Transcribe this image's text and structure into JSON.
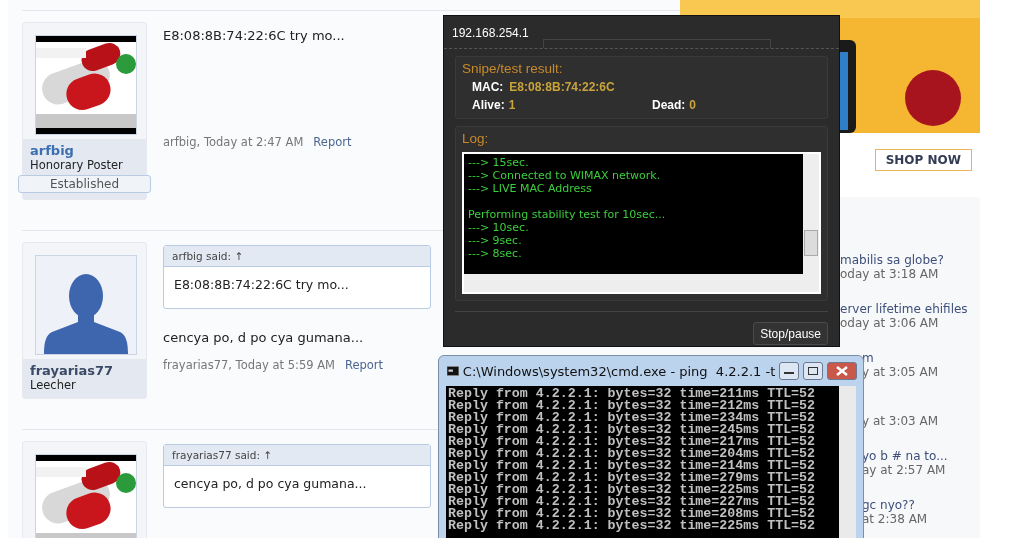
{
  "posts": [
    {
      "author": "arfbig",
      "color": "#3d6fb0",
      "user_title": "Honorary Poster",
      "banner": "Established",
      "message": "E8:08:8B:74:22:6C try mo...",
      "meta": "arfbig, Today at 2:47 AM",
      "report": "Report"
    },
    {
      "avatar": {
        "kind": "silhouette"
      },
      "author": "frayarias77",
      "color": "#3b4a66",
      "user_title": "Leecher",
      "quote": {
        "attribution": "arfbig said: ↑",
        "text": "E8:08:8B:74:22:6C try mo..."
      },
      "message": "cencya po, d po cya gumana...",
      "meta": "frayarias77, Today at 5:59 AM",
      "report": "Report"
    },
    {
      "quote": {
        "attribution": "frayarias77 said: ↑",
        "text": "cencya po, d po cya gumana..."
      }
    }
  ],
  "sidebar": {
    "shop_button": "SHOP NOW",
    "threads": [
      {
        "title": "mabilis sa globe?",
        "meta": "oday at 3:18 AM"
      },
      {
        "title": "erver lifetime ehifiles",
        "meta": "oday at 3:06 AM"
      },
      {
        "title": "m",
        "meta": "y at 3:05 AM"
      },
      {
        "meta": "y at 3:03 AM"
      },
      {
        "title": "yo b # na to...",
        "meta": "ay at 2:57 AM"
      },
      {
        "title": "gc nyo??",
        "meta": "at 2:38 AM"
      }
    ]
  },
  "sniper_window": {
    "tab": "192.168.254.1",
    "result_heading": "Snipe/test result:",
    "mac_label": "MAC:",
    "mac": "E8:08:8B:74:22:6C",
    "alive_label": "Alive:",
    "alive": "1",
    "dead_label": "Dead:",
    "dead": "0",
    "log_heading": "Log:",
    "log_blocks": [
      [
        "---> 15sec.",
        "---> Connected to WIMAX network.",
        "---> LIVE MAC Address"
      ],
      [
        "Performing stability test for 10sec...",
        "---> 10sec.",
        "---> 9sec.",
        "---> 8sec."
      ]
    ],
    "button": "Stop/pause"
  },
  "cmd_window": {
    "title": "C:\\Windows\\system32\\cmd.exe - ping  4.2.2.1 -t",
    "lines": [
      "Reply from 4.2.2.1: bytes=32 time=211ms TTL=52",
      "Reply from 4.2.2.1: bytes=32 time=212ms TTL=52",
      "Reply from 4.2.2.1: bytes=32 time=234ms TTL=52",
      "Reply from 4.2.2.1: bytes=32 time=245ms TTL=52",
      "Reply from 4.2.2.1: bytes=32 time=217ms TTL=52",
      "Reply from 4.2.2.1: bytes=32 time=204ms TTL=52",
      "Reply from 4.2.2.1: bytes=32 time=214ms TTL=52",
      "Reply from 4.2.2.1: bytes=32 time=279ms TTL=52",
      "Reply from 4.2.2.1: bytes=32 time=225ms TTL=52",
      "Reply from 4.2.2.1: bytes=32 time=227ms TTL=52",
      "Reply from 4.2.2.1: bytes=32 time=208ms TTL=52",
      "Reply from 4.2.2.1: bytes=32 time=225ms TTL=52"
    ]
  }
}
